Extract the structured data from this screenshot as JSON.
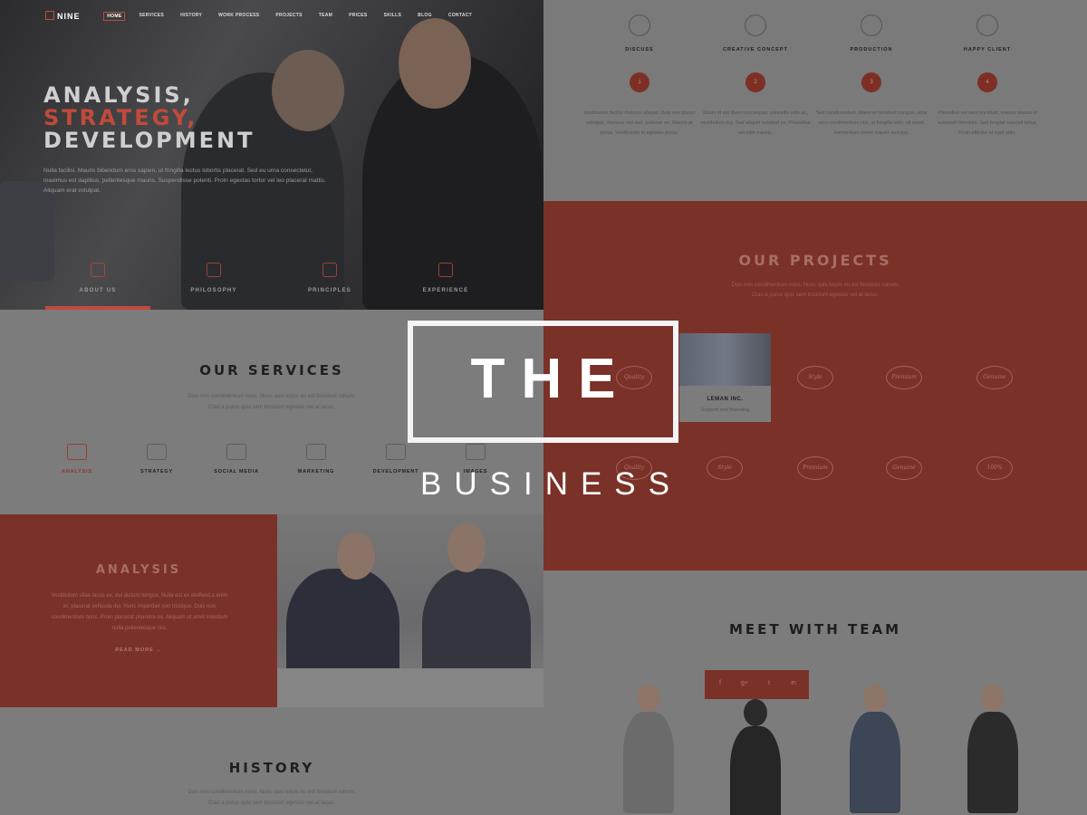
{
  "overlay": {
    "line1": "THE",
    "line2": "BUSINESS"
  },
  "nav": {
    "logo": "NINE",
    "items": [
      "HOME",
      "SERVICES",
      "HISTORY",
      "WORK PROCESS",
      "PROJECTS",
      "TEAM",
      "PRICES",
      "SKILLS",
      "BLOG",
      "CONTACT"
    ],
    "active_index": 0
  },
  "hero": {
    "title_line1": "ANALYSIS,",
    "title_line2": "STRATEGY,",
    "title_line3": "DEVELOPMENT",
    "text": "Nulla facilisi. Mauris bibendum eros sapien, ut fringilla lectus lobortis placerat. Sed eu urna consectetur, maximus est dapibus, pellentesque mauris. Suspendisse potenti. Proin egestas tortor vel leo placerat mattis. Aliquam erat volutpat.",
    "icons": [
      {
        "label": "ABOUT US",
        "icon": "people-icon"
      },
      {
        "label": "PHILOSOPHY",
        "icon": "lightbulb-icon"
      },
      {
        "label": "PRINCIPLES",
        "icon": "compass-icon"
      },
      {
        "label": "EXPERIENCE",
        "icon": "chart-icon"
      }
    ]
  },
  "services": {
    "title": "OUR SERVICES",
    "sub1": "Duis non condimentum nunc. Nunc quis turpis eu est tincidunt rutrum.",
    "sub2": "Cras a purus quis sem tincidunt egestas vel at lacus.",
    "items": [
      {
        "label": "ANALYSIS",
        "icon": "pencil-ruler-icon",
        "active": true
      },
      {
        "label": "STRATEGY",
        "icon": "monitor-icon",
        "active": false
      },
      {
        "label": "SOCIAL MEDIA",
        "icon": "film-icon",
        "active": false
      },
      {
        "label": "MARKETING",
        "icon": "microphone-icon",
        "active": false
      },
      {
        "label": "DEVELOPMENT",
        "icon": "gear-icon",
        "active": false
      },
      {
        "label": "IMAGES",
        "icon": "camera-icon",
        "active": false
      }
    ]
  },
  "analysis": {
    "title": "ANALYSIS",
    "text": "Vestibulum vitae lacus ex, dui dictum tempor. Nulla est ex eleifend a enim et, placerat vehicula dui. Nunc imperdiet non tristique. Duis non condimentum nunc. Proin placerat pharetra ex. Aliquam ut amet interdum nulla pellentesque nisl.",
    "read_more": "READ MORE →"
  },
  "history": {
    "title": "HISTORY",
    "sub1": "Duis non condimentum nunc. Nunc quis turpis eu est tincidunt rutrum.",
    "sub2": "Cras a purus quis sem tincidunt egestas vel at lacus."
  },
  "process": [
    {
      "label": "DISCUSS",
      "num": "1",
      "icon": "chat-bubble-icon",
      "text": "Vestibulum facilisi rhoncus aliquet. Duis non ipsum volutpat, rhoncus nisi sed, pulvinar ex. Mauris at purus. Vestibulum in egestas purus."
    },
    {
      "label": "CREATIVE CONCEPT",
      "num": "2",
      "icon": "lightbulb-icon",
      "text": "Etiam id est libero consequat, convallis odio ac, vestibulum dui. Sed aliquet volutpat ex. Phasellus vel nibh mauris."
    },
    {
      "label": "PRODUCTION",
      "num": "3",
      "icon": "satellite-icon",
      "text": "Sed condimentum, libero et tincidunt congue, urna arcu condimentum nisl, ut fringilla odio, sit amet. Fermentum lorem mauris suscipit."
    },
    {
      "label": "HAPPY CLIENT",
      "num": "4",
      "icon": "heart-icon",
      "text": "Phasellus vel sem tincidunt, viverra massa id euismod interdum. Sed feugiat suscipit tellus. Proin efficitur et eget odio."
    }
  ],
  "projects": {
    "title": "OUR PROJECTS",
    "sub1": "Duis non condimentum nunc. Nunc quis turpis eu est tincidunt rutrum.",
    "sub2": "Cras a purus quis sem tincidunt egestas vel at lacus.",
    "card_name": "LEMAN INC.",
    "card_desc": "Support and Branding",
    "badges_row1": [
      "Quality",
      "Style",
      "Premium",
      "Genuine"
    ],
    "badges_row2": [
      "Quality",
      "Style",
      "Premium",
      "Genuine",
      "100%"
    ]
  },
  "team": {
    "title": "MEET WITH TEAM",
    "social": [
      "f",
      "g+",
      "t",
      "in"
    ]
  }
}
